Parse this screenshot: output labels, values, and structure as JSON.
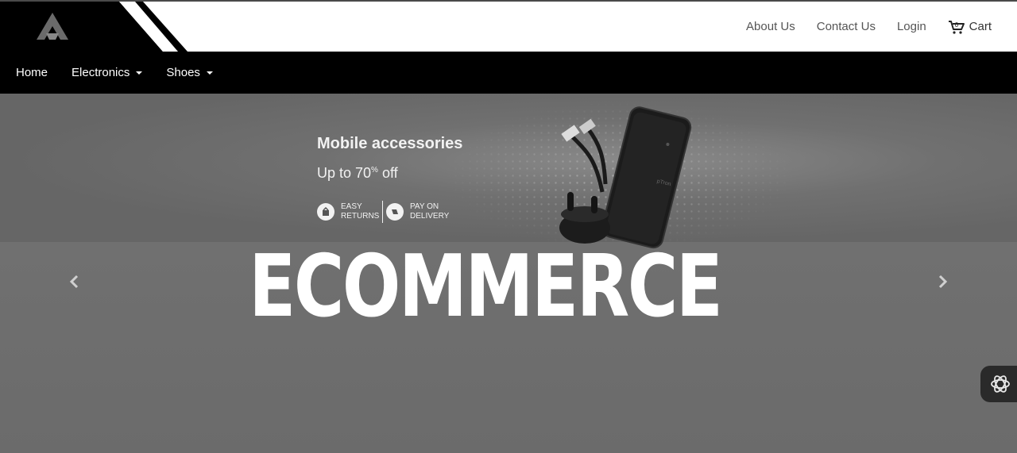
{
  "header": {
    "links": [
      "About Us",
      "Contact Us",
      "Login"
    ],
    "cart_label": "Cart"
  },
  "nav": {
    "home": "Home",
    "electronics": "Electronics",
    "shoes": "Shoes"
  },
  "banner": {
    "promo_title": "Mobile accessories",
    "promo_sub_prefix": "Up to 70",
    "promo_sub_sup": "%",
    "promo_sub_suffix": " off",
    "badge_returns": "EASY RETURNS",
    "badge_delivery": "PAY ON DELIVERY",
    "hero_text": "ECOMMERCE",
    "product_brand": "pTron"
  },
  "icons": {
    "logo": "logo-icon",
    "cart": "cart-icon",
    "prev": "chevron-left-icon",
    "next": "chevron-right-icon",
    "assistant": "ai-assistant-icon"
  },
  "colors": {
    "header_bg": "#ffffff",
    "nav_bg": "#000000",
    "carousel_bg": "#6b6b6b",
    "text_dark": "#555555"
  }
}
